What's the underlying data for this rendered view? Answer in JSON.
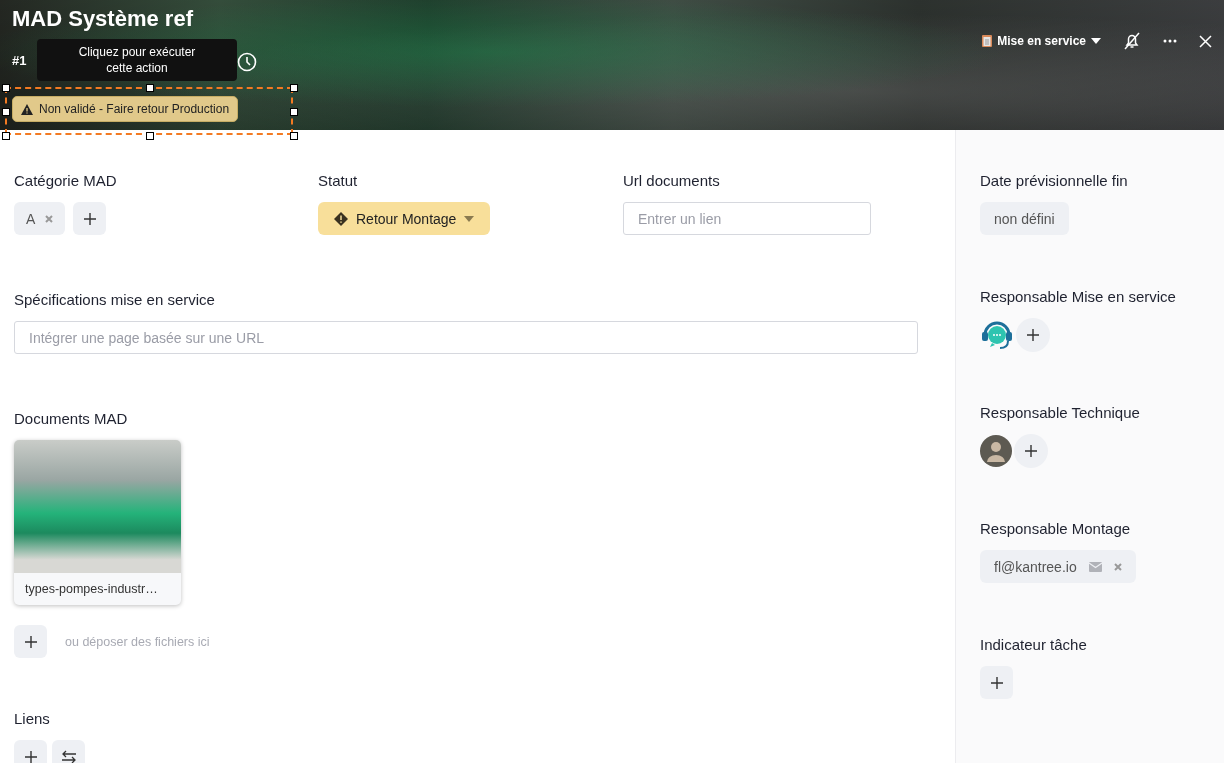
{
  "header": {
    "title": "MAD Système ref",
    "number": "#1",
    "tooltip": "Cliquez pour exécuter cette action",
    "action_button": "Non validé - Faire retour Production",
    "stage_menu": "Mise en service",
    "selected_action": true
  },
  "fields": [
    {
      "kind": "tags",
      "label": "Catégorie MAD",
      "tags": [
        "A"
      ]
    },
    {
      "kind": "status",
      "label": "Statut",
      "value": "Retour Montage"
    },
    {
      "kind": "input",
      "label": "Url documents",
      "placeholder": "Entrer un lien"
    },
    {
      "kind": "wide_input",
      "label": "Spécifications mise en service",
      "placeholder": "Intégrer une page basée sur une URL"
    },
    {
      "kind": "files",
      "label": "Documents MAD",
      "files": [
        "types-pompes-industr…"
      ],
      "drop_hint": "ou déposer des fichiers ici"
    },
    {
      "kind": "links",
      "label": "Liens"
    }
  ],
  "sidebar": [
    {
      "kind": "chip",
      "label": "Date prévisionnelle fin",
      "value": "non défini"
    },
    {
      "kind": "bot_assignee",
      "label": "Responsable Mise en service"
    },
    {
      "kind": "photo_assignee",
      "label": "Responsable Technique"
    },
    {
      "kind": "email",
      "label": "Responsable Montage",
      "value": "fl@kantree.io"
    },
    {
      "kind": "add",
      "label": "Indicateur tâche"
    }
  ]
}
